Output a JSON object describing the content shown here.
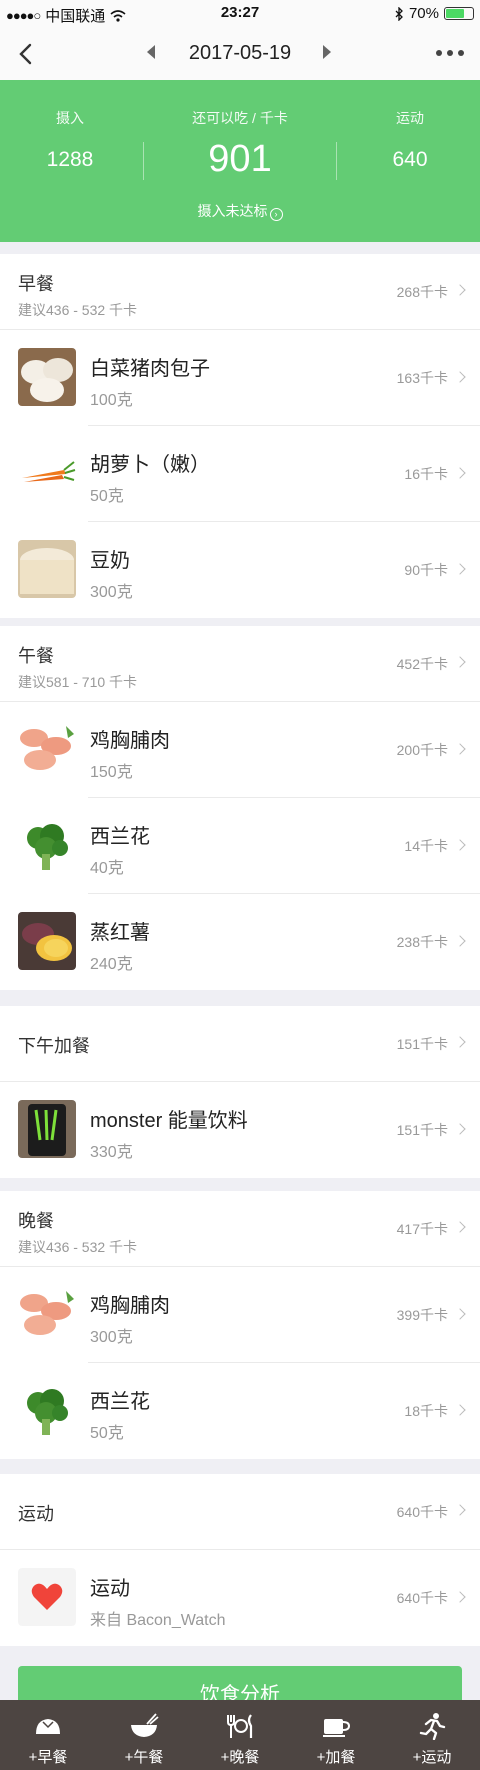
{
  "status_bar": {
    "carrier": "中国联通",
    "time": "23:27",
    "battery": "70%",
    "battery_level": 0.7
  },
  "nav": {
    "date": "2017-05-19"
  },
  "summary": {
    "intake_label": "摄入",
    "intake_value": "1288",
    "remaining_label": "还可以吃 / 千卡",
    "remaining_value": "901",
    "exercise_label": "运动",
    "exercise_value": "640",
    "status": "摄入未达标"
  },
  "meals": [
    {
      "title": "早餐",
      "suggest": "建议436 - 532 千卡",
      "kcal": "268千卡",
      "items": [
        {
          "name": "白菜猪肉包子",
          "amount": "100克",
          "kcal": "163千卡",
          "icon": "baozi-photo"
        },
        {
          "name": "胡萝卜（嫩）",
          "amount": "50克",
          "kcal": "16千卡",
          "icon": "carrot-photo"
        },
        {
          "name": "豆奶",
          "amount": "300克",
          "kcal": "90千卡",
          "icon": "soymilk-photo"
        }
      ]
    },
    {
      "title": "午餐",
      "suggest": "建议581 - 710 千卡",
      "kcal": "452千卡",
      "items": [
        {
          "name": "鸡胸脯肉",
          "amount": "150克",
          "kcal": "200千卡",
          "icon": "chicken-photo"
        },
        {
          "name": "西兰花",
          "amount": "40克",
          "kcal": "14千卡",
          "icon": "broccoli-photo"
        },
        {
          "name": "蒸红薯",
          "amount": "240克",
          "kcal": "238千卡",
          "icon": "sweet-potato-photo"
        }
      ]
    },
    {
      "title": "下午加餐",
      "suggest": "",
      "kcal": "151千卡",
      "items": [
        {
          "name": "monster 能量饮料",
          "amount": "330克",
          "kcal": "151千卡",
          "icon": "energy-drink-photo"
        }
      ]
    },
    {
      "title": "晚餐",
      "suggest": "建议436 - 532 千卡",
      "kcal": "417千卡",
      "items": [
        {
          "name": "鸡胸脯肉",
          "amount": "300克",
          "kcal": "399千卡",
          "icon": "chicken-photo"
        },
        {
          "name": "西兰花",
          "amount": "50克",
          "kcal": "18千卡",
          "icon": "broccoli-photo"
        }
      ]
    },
    {
      "title": "运动",
      "suggest": "",
      "kcal": "640千卡",
      "items": [
        {
          "name": "运动",
          "amount": "来自 Bacon_Watch",
          "kcal": "640千卡",
          "icon": "heart-icon"
        }
      ]
    }
  ],
  "analysis_button": "饮食分析",
  "tabs": [
    {
      "label": "+早餐",
      "icon": "bun-icon"
    },
    {
      "label": "+午餐",
      "icon": "bowl-icon"
    },
    {
      "label": "+晚餐",
      "icon": "cutlery-icon"
    },
    {
      "label": "+加餐",
      "icon": "cup-icon"
    },
    {
      "label": "+运动",
      "icon": "runner-icon"
    }
  ]
}
